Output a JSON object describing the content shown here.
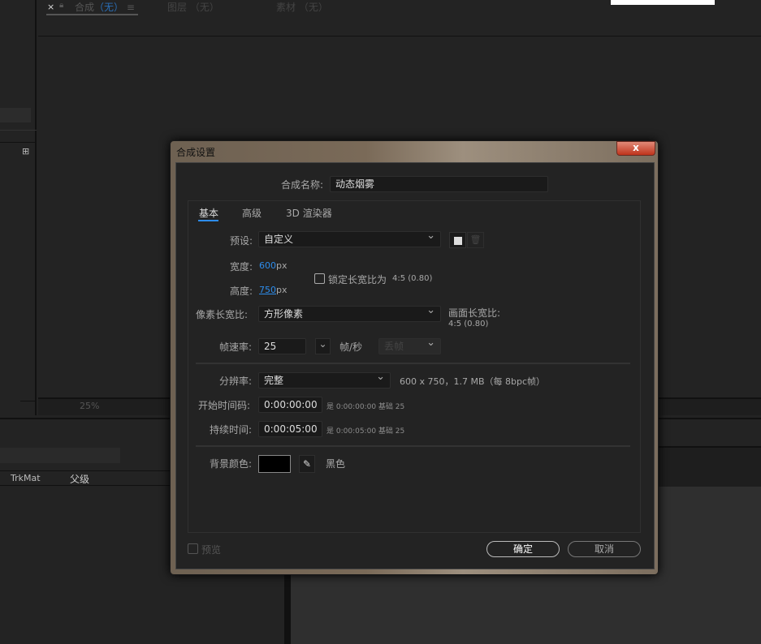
{
  "top_tabs": {
    "close": "×",
    "comp_label": "合成",
    "comp_value": "（无）",
    "menu": "≡",
    "layer": "图层 （无）",
    "footage": "素材 （无）"
  },
  "viewer_toolbar": {
    "zoom": "25%"
  },
  "timeline": {
    "col_trkmat": "TrkMat",
    "col_parent": "父级"
  },
  "dialog": {
    "title": "合成设置",
    "close": "x",
    "name_label": "合成名称:",
    "name_value": "动态烟雾",
    "tabs": [
      "基本",
      "高级",
      "3D 渲染器"
    ],
    "preset_label": "预设:",
    "preset_value": "自定义",
    "width_label": "宽度:",
    "width_value": "600",
    "width_unit": "px",
    "height_label": "高度:",
    "height_value": "750",
    "height_unit": "px",
    "lock_label": "锁定长宽比为",
    "lock_ratio": "4:5 (0.80)",
    "par_label": "像素长宽比:",
    "par_value": "方形像素",
    "frame_aspect_label": "画面长宽比:",
    "frame_aspect_value": "4:5 (0.80)",
    "fps_label": "帧速率:",
    "fps_value": "25",
    "fps_unit": "帧/秒",
    "drop_frame": "丢帧",
    "res_label": "分辨率:",
    "res_value": "完整",
    "res_info": "600 x 750，1.7 MB（每 8bpc帧）",
    "start_label": "开始时间码:",
    "start_value": "0:00:00:00",
    "start_info": "是 0:00:00:00  基础 25",
    "dur_label": "持续时间:",
    "dur_value": "0:00:05:00",
    "dur_info": "是 0:00:05:00  基础 25",
    "bg_label": "背景颜色:",
    "bg_color": "#000000",
    "bg_name": "黑色",
    "preview": "预览",
    "ok": "确定",
    "cancel": "取消"
  }
}
